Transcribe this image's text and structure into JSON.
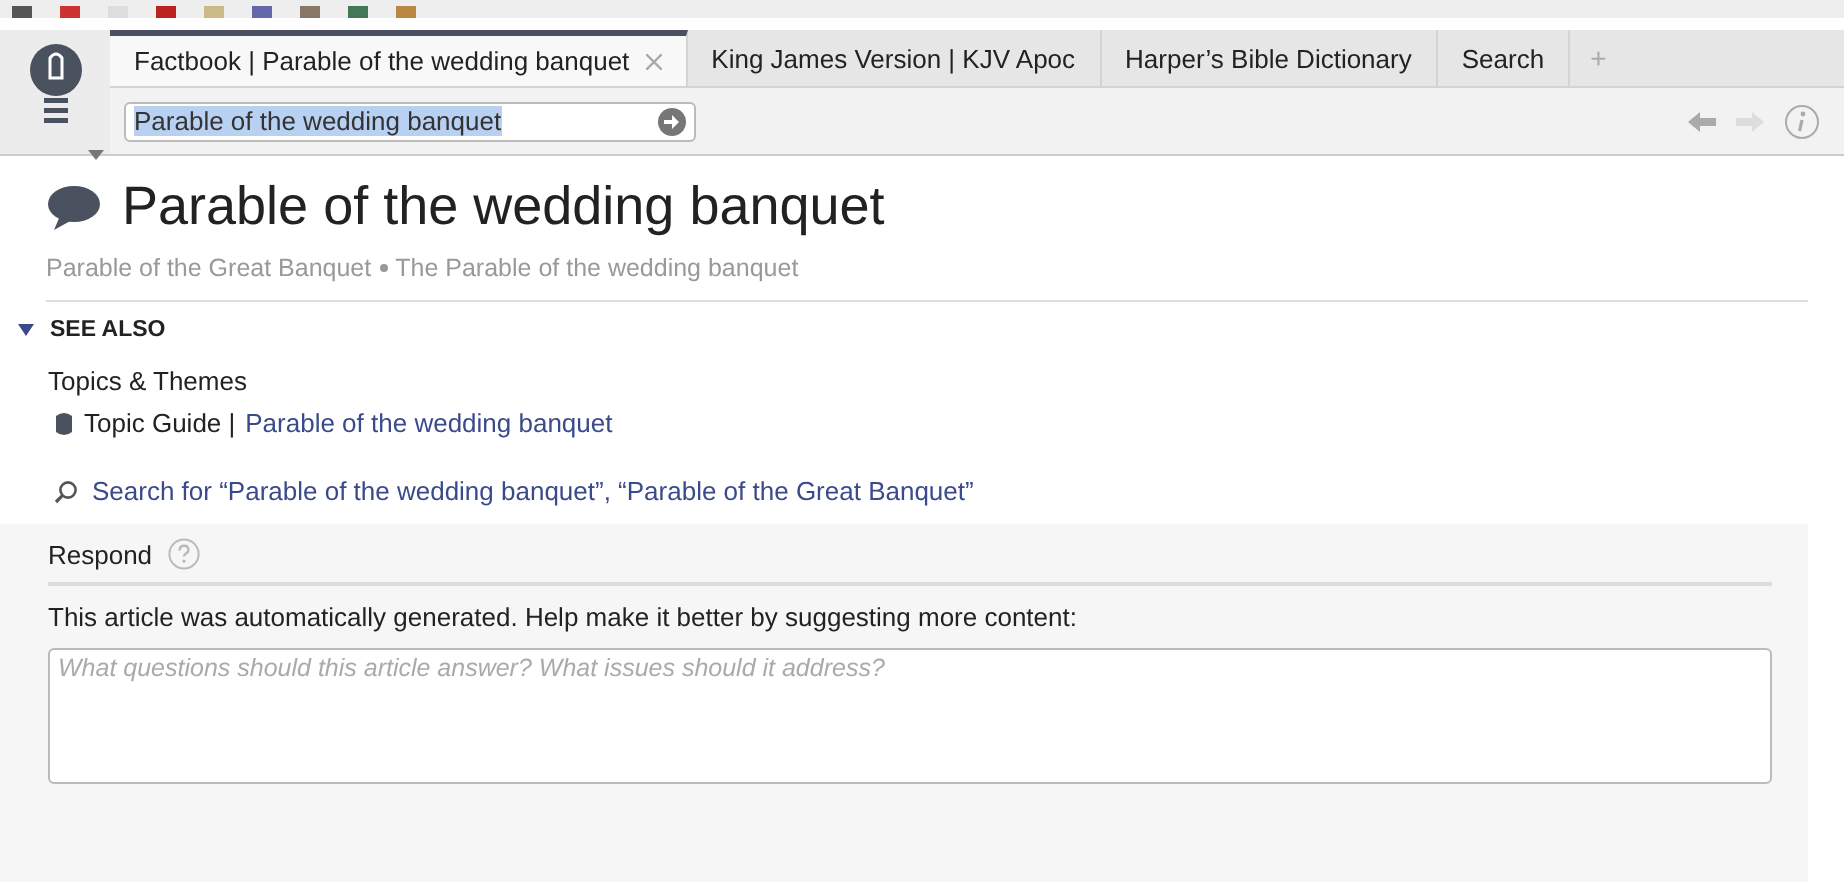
{
  "tabs": [
    {
      "label": "Factbook | Parable of the wedding banquet",
      "selected": true,
      "closable": true
    },
    {
      "label": "King James Version | KJV Apoc",
      "selected": false,
      "closable": false
    },
    {
      "label": "Harper’s Bible Dictionary",
      "selected": false,
      "closable": false
    },
    {
      "label": "Search",
      "selected": false,
      "closable": false
    }
  ],
  "new_tab": "+",
  "address": {
    "value": "Parable of the wedding banquet"
  },
  "article": {
    "title": "Parable of the wedding banquet",
    "aliases": [
      "Parable of the Great Banquet",
      "The Parable of the wedding banquet"
    ],
    "see_also": {
      "heading": "SEE ALSO",
      "expanded": true,
      "group": "Topics & Themes",
      "items": [
        {
          "prefix": "Topic Guide |",
          "link": "Parable of the wedding banquet"
        }
      ],
      "search": "Search for “Parable of the wedding banquet”, “Parable of the Great Banquet”"
    }
  },
  "respond": {
    "heading": "Respond",
    "message": "This article was automatically generated. Help make it better by suggesting more content:",
    "placeholder": "What questions should this article answer? What issues should it address?"
  }
}
